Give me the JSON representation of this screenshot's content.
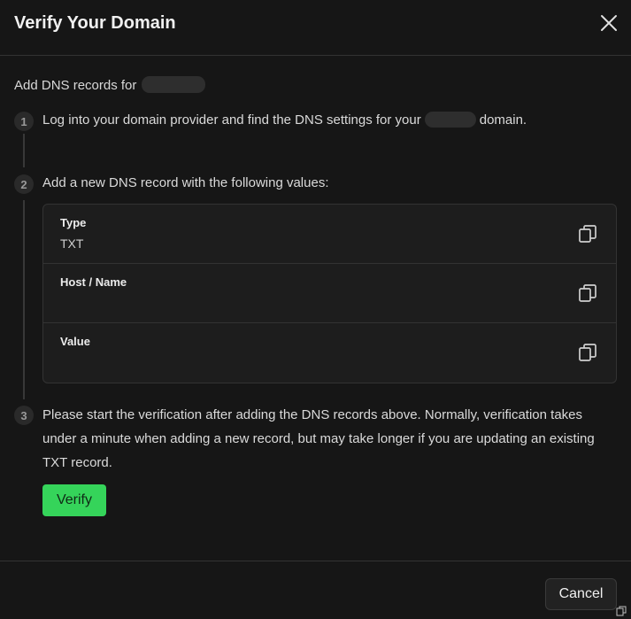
{
  "dialog": {
    "title": "Verify Your Domain",
    "intro": "Add DNS records for",
    "steps": [
      {
        "number": "1",
        "text_before": "Log into your domain provider and find the DNS settings for your",
        "text_after": "domain."
      },
      {
        "number": "2",
        "text": "Add a new DNS record with the following values:"
      },
      {
        "number": "3",
        "text": "Please start the verification after adding the DNS records above. Normally, verification takes under a minute when adding a new record, but may take longer if you are updating an existing TXT record."
      }
    ],
    "records": [
      {
        "label": "Type",
        "value": "TXT"
      },
      {
        "label": "Host / Name",
        "value": ""
      },
      {
        "label": "Value",
        "value": ""
      }
    ],
    "verify_label": "Verify",
    "cancel_label": "Cancel"
  },
  "icons": {
    "close": "close-icon",
    "copy": "copy-icon"
  },
  "colors": {
    "background": "#161616",
    "accent_green": "#35d45a",
    "border": "#333333"
  }
}
